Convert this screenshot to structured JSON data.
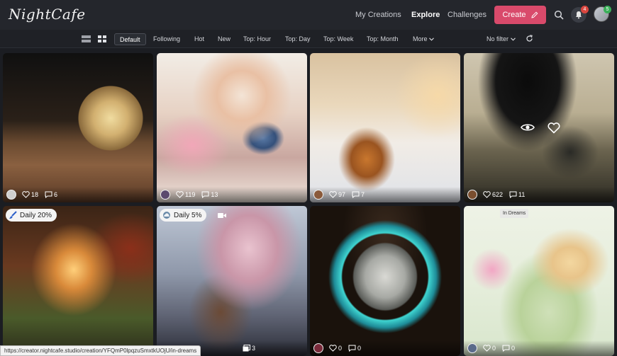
{
  "app": {
    "logo": "NightCafe"
  },
  "nav": {
    "links": [
      {
        "label": "My Creations",
        "active": false
      },
      {
        "label": "Explore",
        "active": true
      },
      {
        "label": "Challenges",
        "active": false
      }
    ],
    "create_label": "Create",
    "notification_count": "4",
    "avatar_badge": "5"
  },
  "filters": {
    "items": [
      "Default",
      "Following",
      "Hot",
      "New",
      "Top: Hour",
      "Top: Day",
      "Top: Week",
      "Top: Month",
      "More"
    ],
    "selected": "Default",
    "no_filter": "No filter"
  },
  "cards": [
    {
      "likes": "18",
      "comments": "6",
      "pill": "",
      "in_dreams": ""
    },
    {
      "likes": "119",
      "comments": "13",
      "pill": "",
      "in_dreams": ""
    },
    {
      "likes": "97",
      "comments": "7",
      "pill": "",
      "in_dreams": ""
    },
    {
      "likes": "622",
      "comments": "11",
      "pill": "",
      "in_dreams": ""
    },
    {
      "likes": "",
      "comments": "",
      "pill": "Daily 20%",
      "in_dreams": ""
    },
    {
      "likes": "",
      "comments": "",
      "extra": "3",
      "pill": "Daily 5%",
      "in_dreams": ""
    },
    {
      "likes": "0",
      "comments": "0",
      "pill": "",
      "in_dreams": ""
    },
    {
      "likes": "0",
      "comments": "0",
      "pill": "",
      "in_dreams": "In Dreams"
    }
  ],
  "status_url": "https://creator.nightcafe.studio/creation/YFQmP0lpqzuSmxtkUOjU/in-dreams",
  "colors": {
    "accent": "#d94a6b",
    "background": "#1b1d22",
    "topbar": "#24262c"
  }
}
